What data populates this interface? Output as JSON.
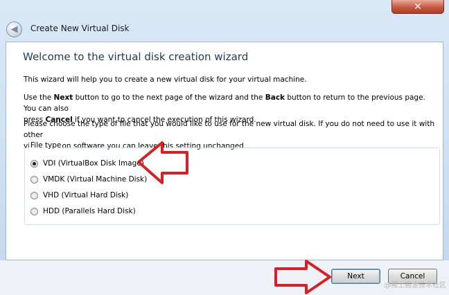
{
  "window": {
    "close_glyph": "✕",
    "title": "Create New Virtual Disk",
    "back_glyph": "◀"
  },
  "wizard": {
    "heading": "Welcome to the virtual disk creation wizard",
    "intro": "This wizard will help you to create a new virtual disk for your virtual machine.",
    "nav_text": {
      "p1": "Use the ",
      "next_word": "Next",
      "p2": " button to go to the next page of the wizard and the ",
      "back_word": "Back",
      "p3": " button to return to the previous page. You can also",
      "p4": "press ",
      "cancel_word": "Cancel",
      "p5": " if you want to cancel the execution of this wizard."
    },
    "choose_text_line1": "Please choose the type of file that you would like to use for the new virtual disk. If you do not need to use it with other",
    "choose_text_line2": "virtualization software you can leave this setting unchanged.",
    "file_type": {
      "label": "File type",
      "options": [
        {
          "label": "VDI (VirtualBox Disk Image)",
          "selected": true
        },
        {
          "label": "VMDK (Virtual Machine Disk)",
          "selected": false
        },
        {
          "label": "VHD (Virtual Hard Disk)",
          "selected": false
        },
        {
          "label": "HDD (Parallels Hard Disk)",
          "selected": false
        }
      ]
    }
  },
  "buttons": {
    "next": "Next",
    "cancel": "Cancel"
  },
  "watermark": "@稀土掘金技术社区",
  "colors": {
    "annotation_arrow": "#d61f26",
    "heading": "#1e395b"
  }
}
